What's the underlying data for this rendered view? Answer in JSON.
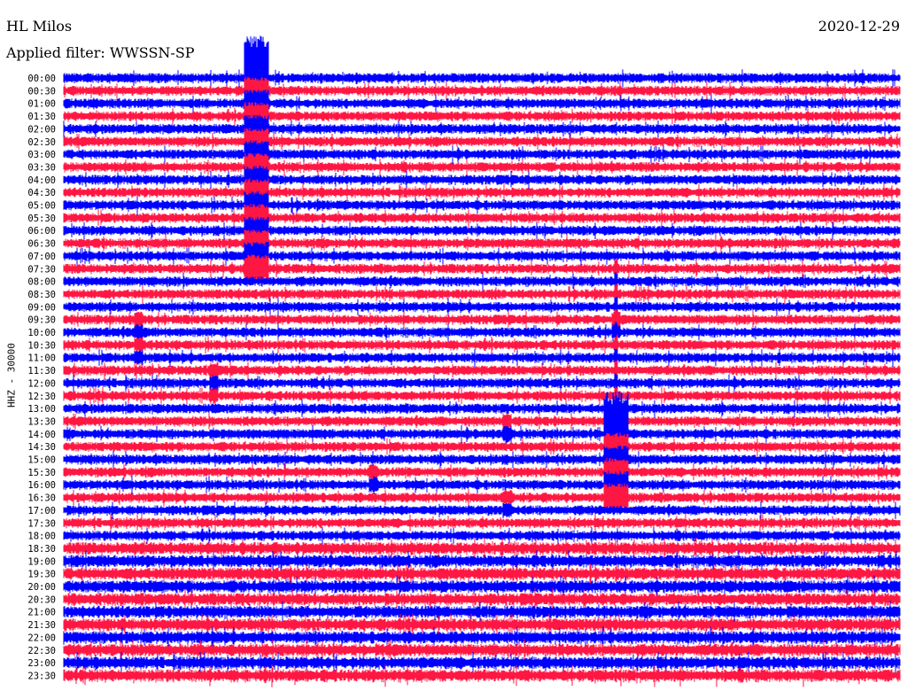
{
  "header": {
    "station": "HL Milos",
    "filter": "Applied filter: WWSSN-SP",
    "date": "2020-12-29"
  },
  "chart_data": {
    "type": "line",
    "title": "HL Milos",
    "subtitle": "Applied filter: WWSSN-SP",
    "date": "2020-12-29",
    "ylabel": "HHZ - 30000",
    "xlabel": "",
    "rows": [
      "00:00",
      "00:30",
      "01:00",
      "01:30",
      "02:00",
      "02:30",
      "03:00",
      "03:30",
      "04:00",
      "04:30",
      "05:00",
      "05:30",
      "06:00",
      "06:30",
      "07:00",
      "07:30",
      "08:00",
      "08:30",
      "09:00",
      "09:30",
      "10:00",
      "10:30",
      "11:00",
      "11:30",
      "12:00",
      "12:30",
      "13:00",
      "13:30",
      "14:00",
      "14:30",
      "15:00",
      "15:30",
      "16:00",
      "16:30",
      "17:00",
      "17:30",
      "18:00",
      "18:30",
      "19:00",
      "19:30",
      "20:00",
      "20:30",
      "21:00",
      "21:30",
      "22:00",
      "22:30",
      "23:00",
      "23:30"
    ],
    "row_colors": [
      "#0000ff",
      "#ff1744"
    ],
    "grid": false,
    "events": [
      {
        "start_row": "00:00",
        "end_row": "07:30",
        "fraction": 0.23,
        "intensity": "strong"
      },
      {
        "start_row": "14:00",
        "end_row": "16:30",
        "fraction": 0.66,
        "intensity": "strong"
      },
      {
        "start_row": "07:30",
        "end_row": "16:00",
        "fraction": 0.66,
        "intensity": "spike"
      },
      {
        "start_row": "09:30",
        "end_row": "11:00",
        "fraction": 0.09,
        "intensity": "moderate"
      },
      {
        "start_row": "11:30",
        "end_row": "12:30",
        "fraction": 0.18,
        "intensity": "moderate"
      },
      {
        "start_row": "13:30",
        "end_row": "14:00",
        "fraction": 0.53,
        "intensity": "moderate"
      },
      {
        "start_row": "15:30",
        "end_row": "16:00",
        "fraction": 0.37,
        "intensity": "moderate"
      },
      {
        "start_row": "16:30",
        "end_row": "17:00",
        "fraction": 0.53,
        "intensity": "moderate"
      },
      {
        "start_row": "09:30",
        "end_row": "10:00",
        "fraction": 0.66,
        "intensity": "moderate"
      }
    ]
  }
}
